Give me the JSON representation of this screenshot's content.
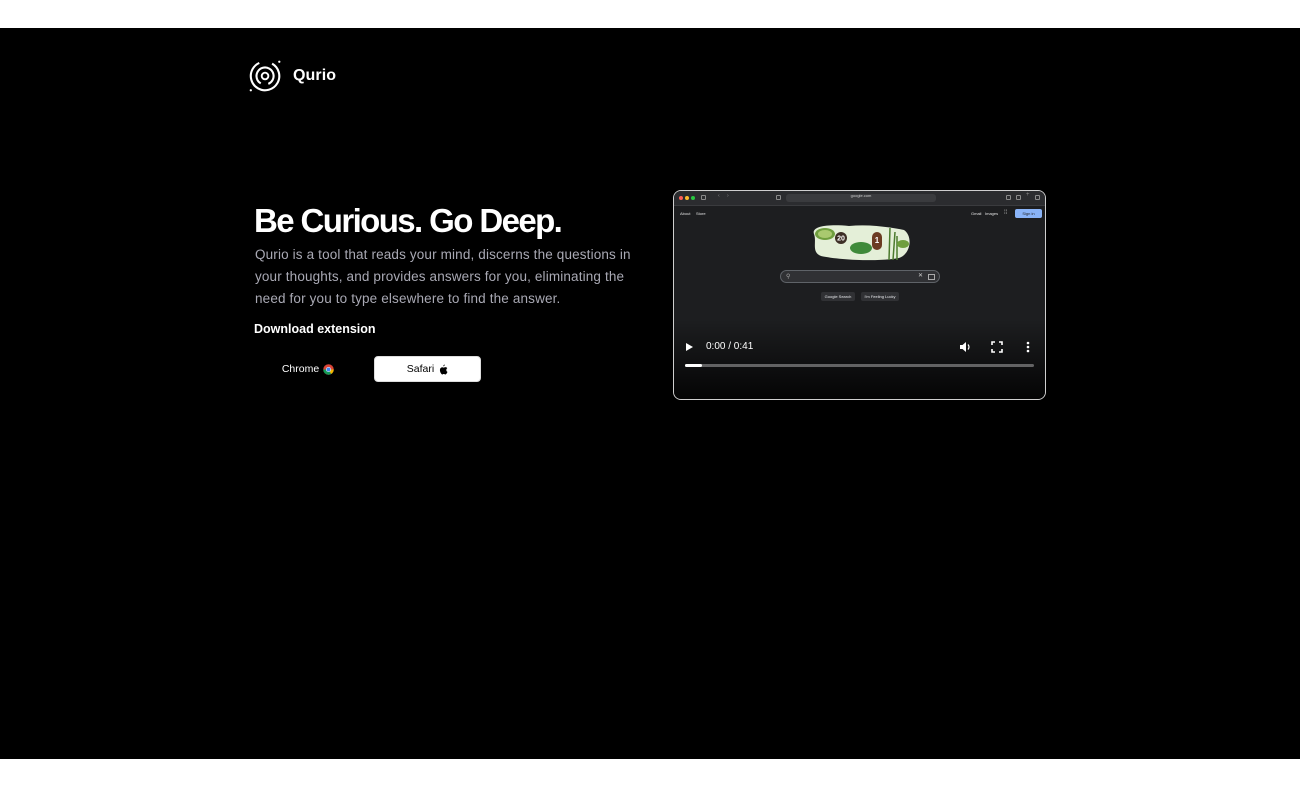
{
  "brand": {
    "name": "Qurio",
    "logo_icon": "swirl-logo-icon"
  },
  "hero": {
    "title": "Be Curious. Go Deep.",
    "description": "Qurio is a tool that reads your mind, discerns the questions in your thoughts, and provides answers for you, eliminating the need for you to type elsewhere to find the answer."
  },
  "download": {
    "label": "Download extension",
    "buttons": [
      {
        "label": "Chrome",
        "icon": "chrome-icon"
      },
      {
        "label": "Safari",
        "icon": "apple-icon"
      }
    ]
  },
  "video": {
    "time_display": "0:00 / 0:41",
    "progress_fraction": 0.05,
    "preview": {
      "url": "google.com",
      "top_links": [
        "About",
        "Store",
        "Gmail",
        "Images"
      ],
      "sign_in": "Sign in",
      "buttons": [
        "Google Search",
        "I'm Feeling Lucky"
      ],
      "doodle_numbers": [
        "20",
        "1"
      ]
    }
  },
  "colors": {
    "background": "#000000",
    "text": "#ffffff",
    "muted_text": "#a9a9b4"
  }
}
